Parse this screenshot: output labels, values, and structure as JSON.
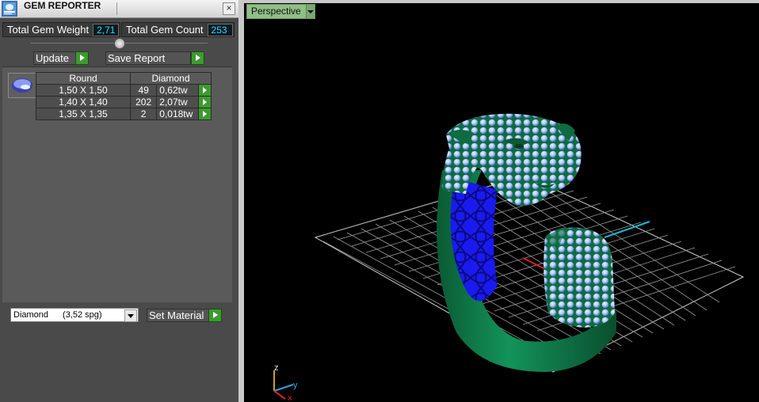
{
  "panel": {
    "title": "GEM REPORTER",
    "close_label": "×",
    "total_weight_label": "Total Gem Weight",
    "total_weight_value": "2,71",
    "total_count_label": "Total Gem Count",
    "total_count_value": "253",
    "update_label": "Update",
    "save_report_label": "Save Report",
    "table": {
      "headers": [
        "Round",
        "Diamond"
      ],
      "rows": [
        {
          "size": "1,50 X 1,50",
          "count": "49",
          "weight": "0,62tw"
        },
        {
          "size": "1,40 X 1,40",
          "count": "202",
          "weight": "2,07tw"
        },
        {
          "size": "1,35 X 1,35",
          "count": "2",
          "weight": "0,018tw"
        }
      ]
    },
    "material": {
      "name": "Diamond",
      "spg": "(3,52 spg)"
    },
    "set_material_label": "Set Material"
  },
  "viewport": {
    "view_label": "Perspective",
    "axis_labels": {
      "z": "z",
      "y": "y",
      "x": "x"
    }
  },
  "colors": {
    "ring_green": "#0f7a4a",
    "gem_blue": "#a9c6ff",
    "inner_blue": "#1a1af0",
    "button_green": "#3d9a2f",
    "value_cyan": "#2ed6ff"
  },
  "icons": [
    "gem-reporter-app-icon",
    "close-icon",
    "play-arrow-icon",
    "dropdown-arrow-icon",
    "gem-thumbnail-icon"
  ]
}
